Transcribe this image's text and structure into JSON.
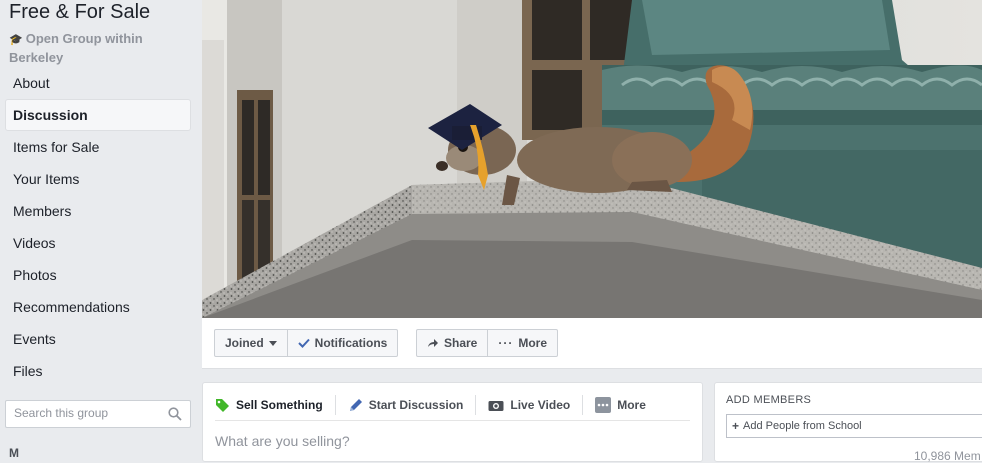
{
  "group": {
    "name": "Free & For Sale",
    "subtitle": "Open Group within Berkeley"
  },
  "sidebar": {
    "items": [
      {
        "label": "About",
        "active": false
      },
      {
        "label": "Discussion",
        "active": true
      },
      {
        "label": "Items for Sale",
        "active": false
      },
      {
        "label": "Your Items",
        "active": false
      },
      {
        "label": "Members",
        "active": false
      },
      {
        "label": "Videos",
        "active": false
      },
      {
        "label": "Photos",
        "active": false
      },
      {
        "label": "Recommendations",
        "active": false
      },
      {
        "label": "Events",
        "active": false
      },
      {
        "label": "Files",
        "active": false
      }
    ],
    "search_placeholder": "Search this group",
    "more_label": "M"
  },
  "actions": {
    "joined": "Joined",
    "notifications": "Notifications",
    "share": "Share",
    "more": "More"
  },
  "composer": {
    "tabs": [
      "Sell Something",
      "Start Discussion",
      "Live Video",
      "More"
    ],
    "placeholder": "What are you selling?"
  },
  "add_members": {
    "title": "ADD MEMBERS",
    "placeholder": "Add People from School",
    "count_partial": "10,986 Mem"
  },
  "colors": {
    "page_bg": "#e9ebee",
    "tab_icon_green": "#42b72a",
    "link_blue": "#4267b2"
  }
}
